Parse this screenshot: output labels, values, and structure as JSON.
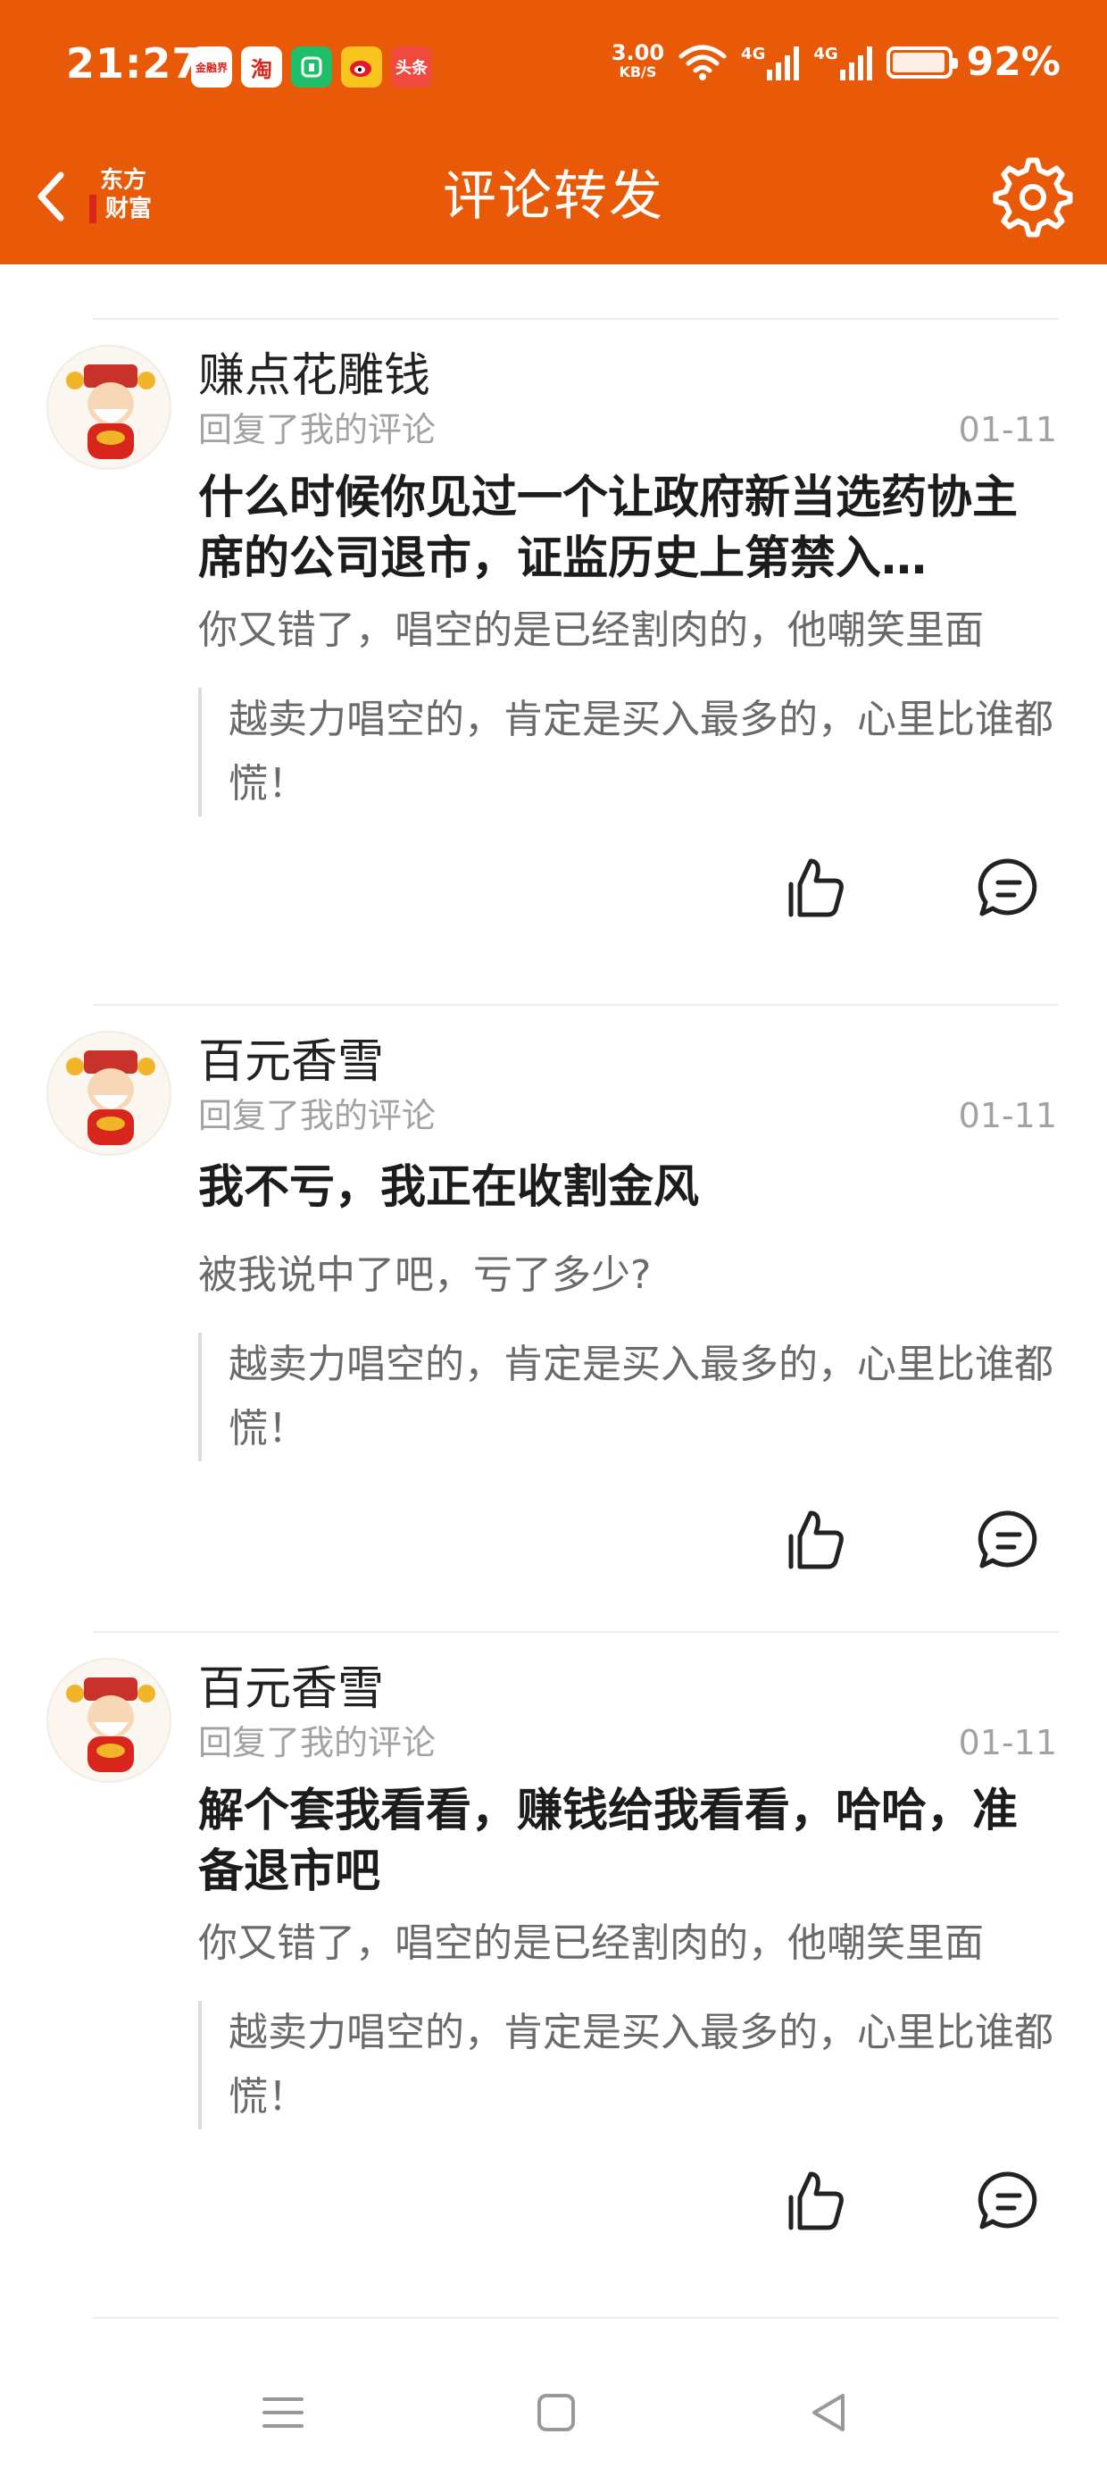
{
  "status_bar": {
    "time": "21:27",
    "app_icons": [
      "金融界",
      "淘",
      "小米",
      "微博",
      "头条"
    ],
    "net_speed": "3.00",
    "net_speed_unit": "KB/S",
    "signal_1": "4G",
    "signal_2": "4G",
    "battery": "92%"
  },
  "title_bar": {
    "logo_line1": "东方",
    "logo_line2": "财富",
    "title": "评论转发"
  },
  "comments": [
    {
      "username": "赚点花雕钱",
      "subtitle": "回复了我的评论",
      "date": "01-11",
      "reply": "什么时候你见过一个让政府新当选药协主席的公司退市，证监历史上第禁入…",
      "my_comment": "你又错了，唱空的是已经割肉的，他嘲笑里面",
      "quote": "越卖力唱空的，肯定是买入最多的，心里比谁都慌！"
    },
    {
      "username": "百元香雪",
      "subtitle": "回复了我的评论",
      "date": "01-11",
      "reply": "我不亏，我正在收割金风",
      "my_comment": "被我说中了吧，亏了多少?",
      "quote": "越卖力唱空的，肯定是买入最多的，心里比谁都慌！"
    },
    {
      "username": "百元香雪",
      "subtitle": "回复了我的评论",
      "date": "01-11",
      "reply": "解个套我看看，赚钱给我看看，哈哈，准备退市吧",
      "my_comment": "你又错了，唱空的是已经割肉的，他嘲笑里面",
      "quote": "越卖力唱空的，肯定是买入最多的，心里比谁都慌！"
    }
  ],
  "colors": {
    "brand": "#E85A07",
    "text_primary": "#1c1c1c",
    "text_secondary": "#6a6a6a",
    "text_meta": "#a2a2a2"
  }
}
